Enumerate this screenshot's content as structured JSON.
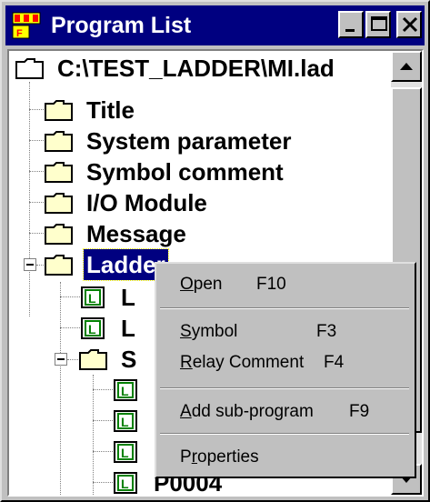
{
  "window": {
    "title": "Program List",
    "app_icon": "program-list-icon",
    "controls": [
      "minimize-icon",
      "maximize-icon",
      "close-icon"
    ]
  },
  "tree": {
    "root": "C:\\TEST_LADDER\\MI.lad",
    "folders": [
      "Title",
      "System parameter",
      "Symbol comment",
      "I/O Module",
      "Message"
    ],
    "ladder": "Ladder",
    "ladder_children": [
      "L",
      "L"
    ],
    "sub_folder": "S",
    "bottom_item": "P0004",
    "ladder_file_icon": "ladder-file-icon",
    "folder_icon": "folder-icon"
  },
  "context_menu": {
    "items": [
      {
        "accel": "O",
        "rest": "pen",
        "key": "F10"
      },
      {
        "accel": "S",
        "rest": "ymbol",
        "key": "F3"
      },
      {
        "accel": "R",
        "rest": "elay Comment",
        "key": "F4"
      },
      {
        "accel": "A",
        "rest": "dd sub-program",
        "key": "F9"
      },
      {
        "pre": "P",
        "accel": "r",
        "rest": "operties",
        "key": ""
      }
    ]
  },
  "colors": {
    "titlebar": "#000080",
    "selection": "#000080",
    "ladder_icon_green": "#008000",
    "face": "#c0c0c0"
  }
}
